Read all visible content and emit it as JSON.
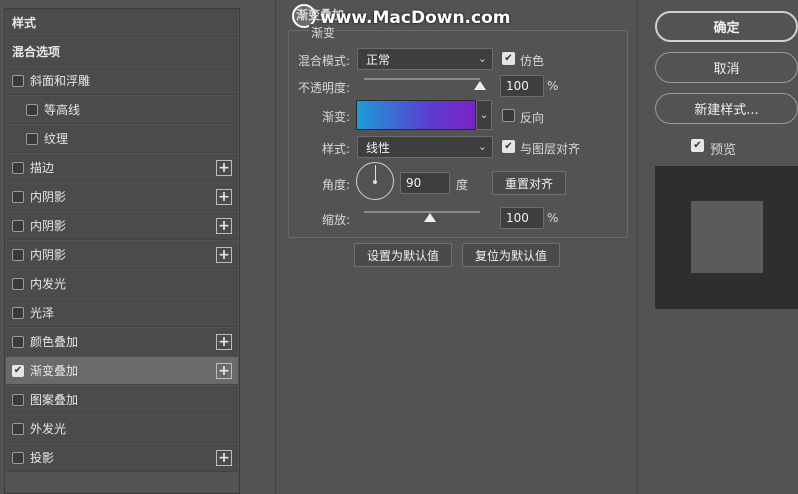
{
  "left_list": {
    "items": [
      {
        "label": "样式",
        "type": "header"
      },
      {
        "label": "混合选项",
        "type": "header"
      },
      {
        "label": "斜面和浮雕",
        "checked": false,
        "plus": false
      },
      {
        "label": "等高线",
        "checked": false,
        "plus": false,
        "indent": true
      },
      {
        "label": "纹理",
        "checked": false,
        "plus": false,
        "indent": true
      },
      {
        "label": "描边",
        "checked": false,
        "plus": true
      },
      {
        "label": "内阴影",
        "checked": false,
        "plus": true
      },
      {
        "label": "内阴影",
        "checked": false,
        "plus": true
      },
      {
        "label": "内阴影",
        "checked": false,
        "plus": true
      },
      {
        "label": "内发光",
        "checked": false,
        "plus": false
      },
      {
        "label": "光泽",
        "checked": false,
        "plus": false
      },
      {
        "label": "颜色叠加",
        "checked": false,
        "plus": true
      },
      {
        "label": "渐变叠加",
        "checked": true,
        "plus": true,
        "selected": true
      },
      {
        "label": "图案叠加",
        "checked": false,
        "plus": false
      },
      {
        "label": "外发光",
        "checked": false,
        "plus": false
      },
      {
        "label": "投影",
        "checked": false,
        "plus": true
      }
    ]
  },
  "panel": {
    "title": "渐变叠加",
    "section": "渐变",
    "blend_mode_label": "混合模式:",
    "blend_mode_value": "正常",
    "dither_label": "仿色",
    "opacity_label": "不透明度:",
    "opacity_value": "100",
    "opacity_unit": "%",
    "opacity_level": 1.0,
    "gradient_label": "渐变:",
    "reverse_label": "反向",
    "style_label": "样式:",
    "style_value": "线性",
    "align_label": "与图层对齐",
    "angle_label": "角度:",
    "angle_value": "90",
    "angle_unit": "度",
    "reset_align_label": "重置对齐",
    "scale_label": "缩放:",
    "scale_value": "100",
    "scale_unit": "%",
    "scale_level": 0.5,
    "set_default_label": "设置为默认值",
    "reset_default_label": "复位为默认值"
  },
  "right": {
    "ok_label": "确定",
    "cancel_label": "取消",
    "new_style_label": "新建样式...",
    "preview_label": "预览"
  },
  "watermark": "www.MacDown.com",
  "colors": {
    "gradient_start": "#1e9bd8",
    "gradient_end": "#7a22c8"
  }
}
